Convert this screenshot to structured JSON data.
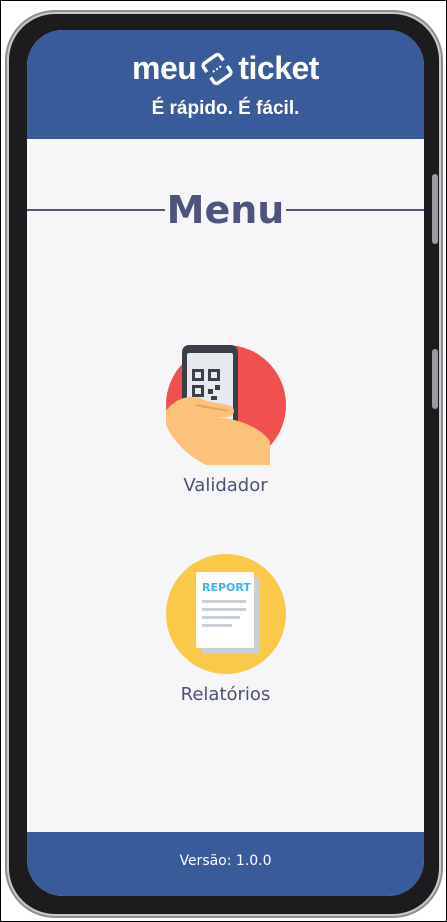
{
  "header": {
    "logo_left": "meu",
    "logo_right": "ticket",
    "tagline": "É rápido. É fácil."
  },
  "main": {
    "title": "Menu",
    "items": [
      {
        "label": "Validador",
        "icon": "qr-phone-icon"
      },
      {
        "label": "Relatórios",
        "icon": "report-icon",
        "icon_text": "REPORT"
      }
    ]
  },
  "footer": {
    "version": "Versão: 1.0.0"
  },
  "colors": {
    "brand": "#3a5b99",
    "background": "#f6f6f9",
    "text": "#4d5371",
    "validador_circle": "#f0504f",
    "relatorios_circle": "#fbc94a"
  }
}
